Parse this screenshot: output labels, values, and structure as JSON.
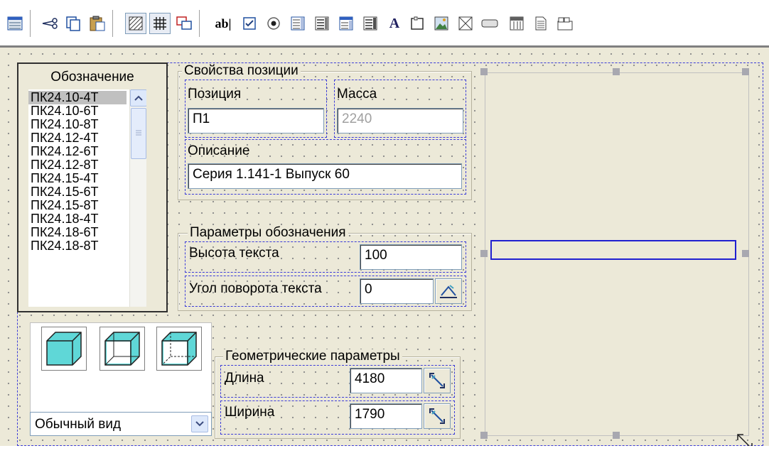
{
  "toolbar": {
    "buttons": [
      "grid-icon",
      "cut-icon",
      "copy-icon",
      "paste-icon",
      "hatch-fill-icon",
      "grid-pattern-icon",
      "bring-front-icon",
      "text-field-icon",
      "checkbox-icon",
      "radio-icon",
      "list-icon",
      "list-alt-icon",
      "grid-list-icon",
      "grid-list-alt-icon",
      "label-icon",
      "groupbox-icon",
      "image-icon",
      "picture-frame-icon",
      "button-icon",
      "calendar-icon",
      "document-icon",
      "tabs-icon"
    ],
    "text_field_label": "ab|",
    "label_label": "A"
  },
  "designation": {
    "title": "Обозначение",
    "items": [
      "ПК24.10-4Т",
      "ПК24.10-6Т",
      "ПК24.10-8Т",
      "ПК24.12-4Т",
      "ПК24.12-6Т",
      "ПК24.12-8Т",
      "ПК24.15-4Т",
      "ПК24.15-6Т",
      "ПК24.15-8Т",
      "ПК24.18-4Т",
      "ПК24.18-6Т",
      "ПК24.18-8Т"
    ],
    "selected_index": 0
  },
  "position_props": {
    "title": "Свойства позиции",
    "position_label": "Позиция",
    "position_value": "П1",
    "mass_label": "Масса",
    "mass_value": "2240",
    "description_label": "Описание",
    "description_value": "Серия 1.141-1 Выпуск 60"
  },
  "designation_params": {
    "title": "Параметры обозначения",
    "text_height_label": "Высота текста",
    "text_height_value": "100",
    "rotation_label": "Угол поворота текста",
    "rotation_value": "0"
  },
  "view": {
    "selected": "Обычный вид",
    "colors": {
      "cube_fill": "#5fd7d7"
    }
  },
  "geometry": {
    "title": "Геометрические параметры",
    "length_label": "Длина",
    "length_value": "4180",
    "width_label": "Ширина",
    "width_value": "1790"
  }
}
